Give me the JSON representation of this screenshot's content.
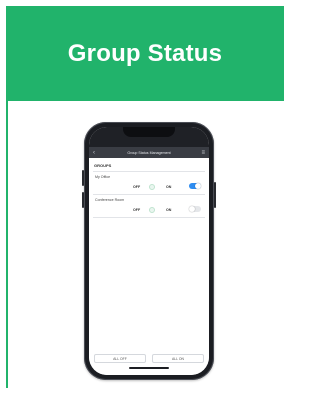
{
  "header": {
    "title": "Group Status"
  },
  "phone": {
    "app_bar": {
      "title": "Group Status Management",
      "back_icon": "chevron-left-icon",
      "menu_icon": "menu-icon"
    },
    "section": "GROUPS",
    "rows": [
      {
        "label": "My Office",
        "value_left": "OFF",
        "value_right": "ON",
        "toggle_on": true
      },
      {
        "label": "Conference Room",
        "value_left": "OFF",
        "value_right": "ON",
        "toggle_on": false
      }
    ],
    "buttons": {
      "left": "ALL OFF",
      "right": "ALL ON"
    }
  },
  "colors": {
    "accent": "#21b36b",
    "toggle_on": "#2e8cf0"
  }
}
